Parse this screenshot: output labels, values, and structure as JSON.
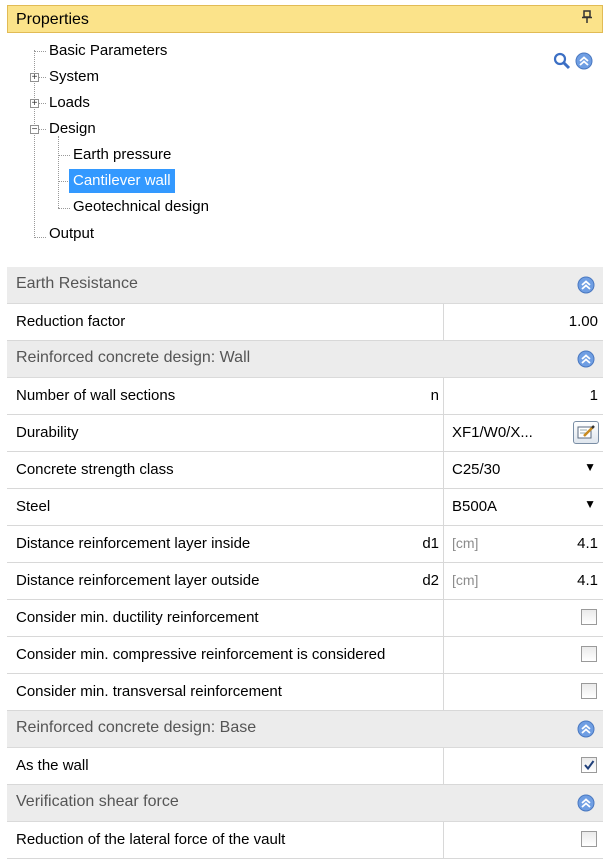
{
  "panel": {
    "title": "Properties",
    "pin_glyph": "📌"
  },
  "nav": {
    "items": [
      {
        "label": "Basic Parameters",
        "level": 1
      },
      {
        "label": "System",
        "level": 1,
        "expander": "+"
      },
      {
        "label": "Loads",
        "level": 1,
        "expander": "+"
      },
      {
        "label": "Design",
        "level": 1,
        "expander": "−"
      },
      {
        "label": "Earth pressure",
        "level": 2
      },
      {
        "label": "Cantilever wall",
        "level": 2,
        "selected": true
      },
      {
        "label": "Geotechnical design",
        "level": 2
      },
      {
        "label": "Output",
        "level": 1
      }
    ],
    "icons": [
      "search-icon",
      "collapse-all-icon"
    ]
  },
  "categories": {
    "earth_resistance": "Earth Resistance",
    "rc_wall": "Reinforced concrete design: Wall",
    "rc_base": "Reinforced concrete design: Base",
    "shear": "Verification shear force"
  },
  "props": {
    "reduction_factor": {
      "label": "Reduction factor",
      "value": "1.00"
    },
    "wall_sections": {
      "label": "Number of wall sections",
      "symbol": "n",
      "value": "1"
    },
    "durability": {
      "label": "Durability",
      "value": "XF1/W0/X..."
    },
    "concrete_class": {
      "label": "Concrete strength class",
      "value": "C25/30"
    },
    "steel": {
      "label": "Steel",
      "value": "B500A"
    },
    "d_inside": {
      "label": "Distance reinforcement layer inside",
      "symbol": "d1",
      "unit": "[cm]",
      "value": "4.1"
    },
    "d_outside": {
      "label": "Distance reinforcement layer outside",
      "symbol": "d2",
      "unit": "[cm]",
      "value": "4.1"
    },
    "min_ductility": {
      "label": "Consider min. ductility reinforcement",
      "checked": false
    },
    "min_compressive": {
      "label": "Consider min. compressive reinforcement is considered",
      "checked": false
    },
    "min_transversal": {
      "label": "Consider min. transversal reinforcement",
      "checked": false
    },
    "as_the_wall": {
      "label": "As the wall",
      "checked": true
    },
    "reduction_lateral": {
      "label": "Reduction of the lateral force of the vault",
      "checked": false
    }
  },
  "colors": {
    "accent": "#fbe38a",
    "selection": "#3399ff",
    "category_bg": "#ececec",
    "icon_blue": "#5a8ad6"
  }
}
